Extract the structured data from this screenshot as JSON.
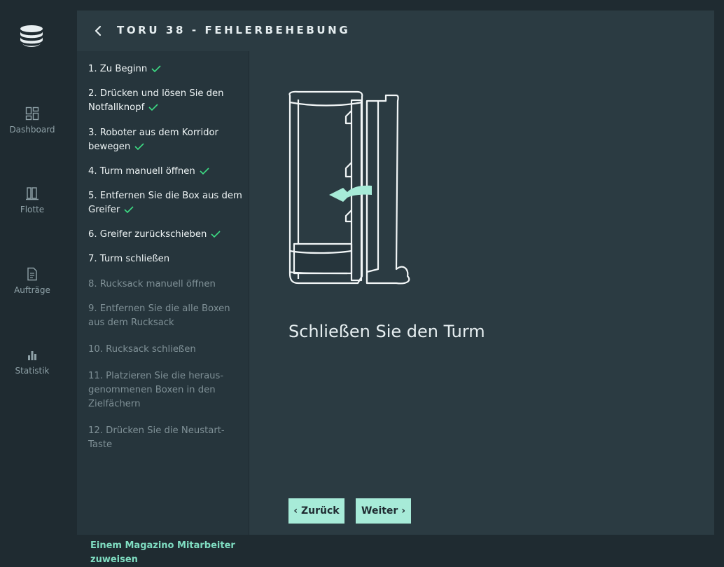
{
  "nav": {
    "items": [
      {
        "label": "Dashboard",
        "icon": "dashboard-icon"
      },
      {
        "label": "Flotte",
        "icon": "fleet-icon"
      },
      {
        "label": "Aufträge",
        "icon": "orders-icon"
      },
      {
        "label": "Statistik",
        "icon": "statistics-icon"
      }
    ]
  },
  "header": {
    "title": "TORU 38 - FEHLERBEHEBUNG",
    "back_icon": "chevron-left-icon"
  },
  "steps": [
    {
      "label": "1. Zu Beginn",
      "status": "done"
    },
    {
      "label": "2. Drücken und lösen Sie den Notfallknopf",
      "status": "done"
    },
    {
      "label": "3. Roboter aus dem Korridor bewegen",
      "status": "done"
    },
    {
      "label": "4. Turm manuell öffnen",
      "status": "done"
    },
    {
      "label": "5. Entfernen Sie die Box aus dem Greifer",
      "status": "done"
    },
    {
      "label": "6. Greifer zurückschieben",
      "status": "done"
    },
    {
      "label": "7. Turm schließen",
      "status": "current"
    },
    {
      "label": "8. Rucksack manuell öffnen",
      "status": "todo"
    },
    {
      "label": "9. Entfernen Sie die alle Boxen aus dem Rucksack",
      "status": "todo"
    },
    {
      "label": "10. Rucksack schließen",
      "status": "todo"
    },
    {
      "label": "11. Platzieren Sie die heraus-genommenen Boxen in den Zielfächern",
      "status": "todo"
    },
    {
      "label": "12. Drücken Sie die Neustart-Taste",
      "status": "todo"
    }
  ],
  "assign_link": "Einem Magazino Mitarbeiter zuweisen",
  "instruction": "Schließen Sie den Turm",
  "buttons": {
    "prev": "‹ Zurück",
    "next": "Weiter ›"
  },
  "colors": {
    "accent": "#a7ebd8",
    "check": "#3ddc84",
    "link": "#7fdcc1"
  }
}
